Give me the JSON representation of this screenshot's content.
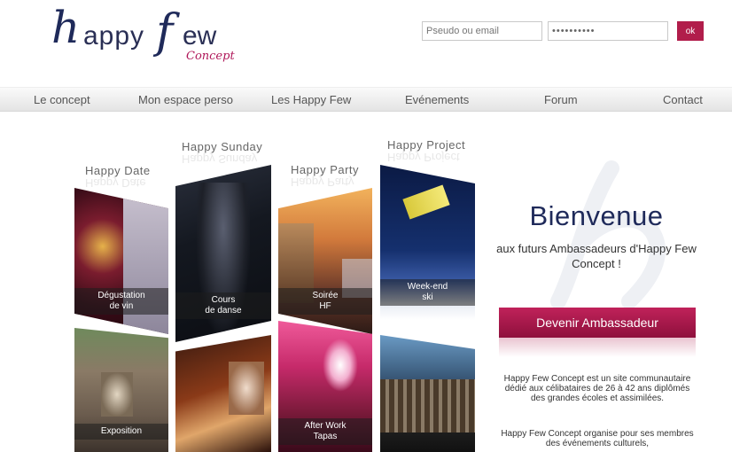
{
  "logo": {
    "h": "h",
    "appy": "appy",
    "f": "f",
    "ew": "ew",
    "concept": "Concept"
  },
  "login": {
    "pseudo_placeholder": "Pseudo ou email",
    "password_value": "••••••••••",
    "ok_label": "ok"
  },
  "nav": {
    "items": [
      "Le concept",
      "Mon espace perso",
      "Les Happy Few",
      "Evénements",
      "Forum",
      "Contact"
    ]
  },
  "categories": [
    "Happy Date",
    "Happy Sunday",
    "Happy Party",
    "Happy Project"
  ],
  "tiles": {
    "degustation": "Dégustation\nde vin",
    "danse": "Cours\nde danse",
    "soiree": "Soirée\nHF",
    "weekend": "Week-end\nski",
    "expo": "Exposition",
    "afterwork": "After Work\nTapas"
  },
  "welcome": {
    "title": "Bienvenue",
    "subtitle": "aux futurs Ambassadeurs d'Happy Few Concept !",
    "cta_label": "Devenir Ambassadeur",
    "desc1": "Happy Few Concept est un site communautaire dédié aux célibataires de 26 à 42 ans diplômés des grandes écoles et assimilées.",
    "desc2": "Happy Few Concept organise pour ses membres des événements culturels,"
  },
  "colors": {
    "accent": "#b11d4b",
    "brand_blue": "#1f2a5a"
  }
}
